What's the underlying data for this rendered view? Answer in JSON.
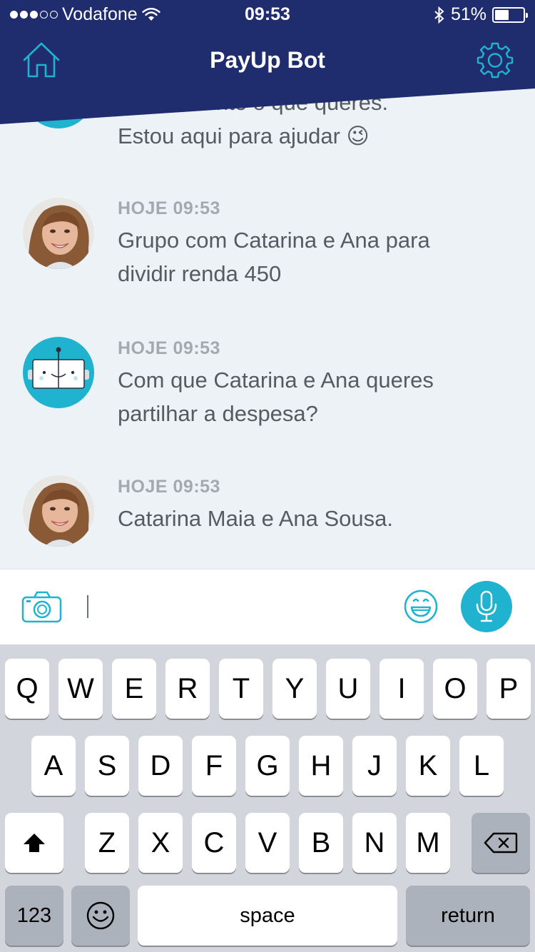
{
  "status_bar": {
    "carrier": "Vodafone",
    "time": "09:53",
    "battery": "51%",
    "battery_level": 0.51
  },
  "header": {
    "title": "PayUp Bot",
    "left_icon": "home-icon",
    "right_icon": "gear-icon",
    "color": "#1f2d6e",
    "accent": "#1fb3d0"
  },
  "messages": [
    {
      "sender": "bot",
      "time": "",
      "text_partial": "naturalmente o que queres.",
      "text": "Estou aqui para ajudar 😉"
    },
    {
      "sender": "user",
      "time": "HOJE 09:53",
      "line1": "Grupo com Catarina e Ana para",
      "line2": "dividir renda 450"
    },
    {
      "sender": "bot",
      "time": "HOJE 09:53",
      "line1": "Com que Catarina e Ana queres",
      "line2": "partilhar a despesa?"
    },
    {
      "sender": "user",
      "time": "HOJE 09:53",
      "line1": "Catarina Maia e Ana Sousa."
    }
  ],
  "input": {
    "value": "",
    "camera_icon": "camera-icon",
    "emoji_icon": "smiley-icon",
    "mic_icon": "microphone-icon"
  },
  "keyboard": {
    "row1": [
      "Q",
      "W",
      "E",
      "R",
      "T",
      "Y",
      "U",
      "I",
      "O",
      "P"
    ],
    "row2": [
      "A",
      "S",
      "D",
      "F",
      "G",
      "H",
      "J",
      "K",
      "L"
    ],
    "row3": [
      "Z",
      "X",
      "C",
      "V",
      "B",
      "N",
      "M"
    ],
    "numbers": "123",
    "space": "space",
    "return": "return"
  }
}
